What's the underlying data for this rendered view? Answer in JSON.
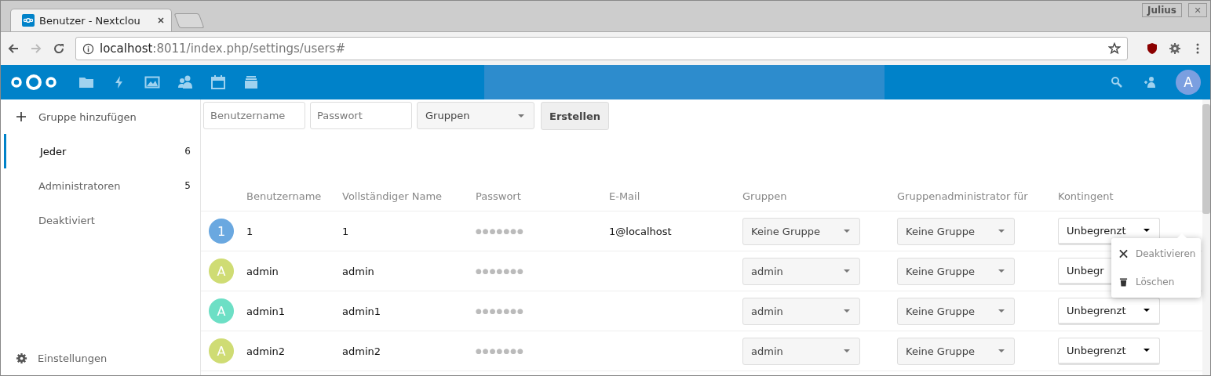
{
  "browser": {
    "tab_title": "Benutzer - Nextclou",
    "profile": "Julius",
    "close": "✕",
    "url_host": "localhost",
    "url_rest": ":8011/index.php/settings/users#"
  },
  "sidebar": {
    "add_group": "Gruppe hinzufügen",
    "items": [
      {
        "label": "Jeder",
        "count": "6",
        "selected": true
      },
      {
        "label": "Administratoren",
        "count": "5",
        "selected": false
      },
      {
        "label": "Deaktiviert",
        "selected": false
      }
    ],
    "settings": "Einstellungen"
  },
  "header": {
    "avatar": "A"
  },
  "new_user": {
    "username_placeholder": "Benutzername",
    "password_placeholder": "Passwort",
    "groups_placeholder": "Gruppen",
    "create": "Erstellen"
  },
  "table": {
    "columns": [
      "Benutzername",
      "Vollständiger Name",
      "Passwort",
      "E-Mail",
      "Gruppen",
      "Gruppenadministrator für",
      "Kontingent"
    ],
    "rows": [
      {
        "avatar": "1",
        "color": "#6aa8e0",
        "username": "1",
        "full_name": "1",
        "password": "●●●●●●●",
        "email": "1@localhost",
        "groups": "Keine Gruppe",
        "subadmin": "Keine Gruppe",
        "quota": "Unbegrenzt"
      },
      {
        "avatar": "A",
        "color": "#cfdc74",
        "username": "admin",
        "full_name": "admin",
        "password": "●●●●●●●",
        "email": "",
        "groups": "admin",
        "subadmin": "Keine Gruppe",
        "quota": "Unbegr"
      },
      {
        "avatar": "A",
        "color": "#6ddfc5",
        "username": "admin1",
        "full_name": "admin1",
        "password": "●●●●●●●",
        "email": "",
        "groups": "admin",
        "subadmin": "Keine Gruppe",
        "quota": "Unbegrenzt"
      },
      {
        "avatar": "A",
        "color": "#cfdc74",
        "username": "admin2",
        "full_name": "admin2",
        "password": "●●●●●●●",
        "email": "",
        "groups": "admin",
        "subadmin": "Keine Gruppe",
        "quota": "Unbegrenzt"
      }
    ]
  },
  "row_menu": {
    "items": [
      {
        "kind": "deactivate",
        "label": "Deaktivieren"
      },
      {
        "kind": "delete",
        "label": "Löschen"
      }
    ]
  }
}
